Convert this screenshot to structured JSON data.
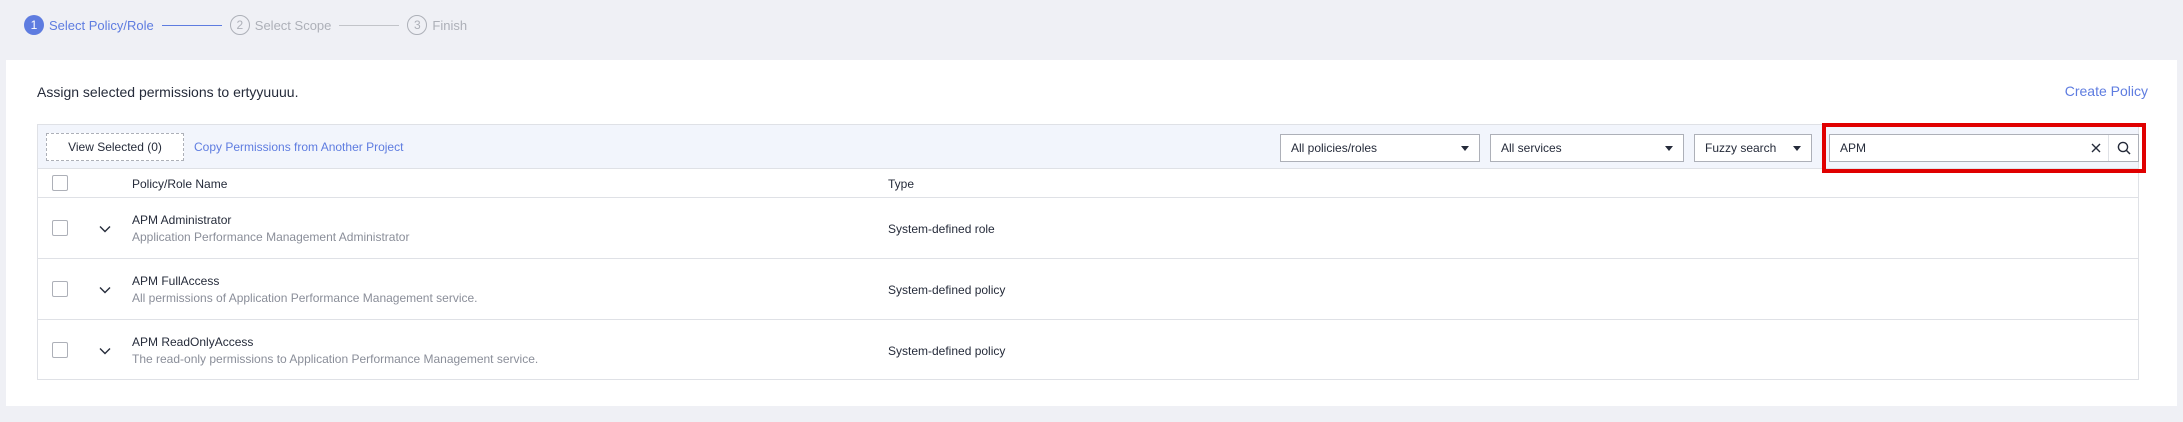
{
  "stepper": {
    "steps": [
      {
        "num": "1",
        "label": "Select Policy/Role",
        "state": "active"
      },
      {
        "num": "2",
        "label": "Select Scope",
        "state": "inactive"
      },
      {
        "num": "3",
        "label": "Finish",
        "state": "inactive"
      }
    ]
  },
  "header": {
    "assign_text": "Assign selected permissions to ertyyuuuu.",
    "create_policy": "Create Policy"
  },
  "toolbar": {
    "view_selected": "View Selected (0)",
    "copy_permissions": "Copy Permissions from Another Project",
    "policy_filter": "All policies/roles",
    "service_filter": "All services",
    "search_mode": "Fuzzy search",
    "search_value": "APM"
  },
  "table": {
    "columns": {
      "name": "Policy/Role Name",
      "type": "Type"
    },
    "rows": [
      {
        "name": "APM Administrator",
        "desc": "Application Performance Management Administrator",
        "type": "System-defined role"
      },
      {
        "name": "APM FullAccess",
        "desc": "All permissions of Application Performance Management service.",
        "type": "System-defined policy"
      },
      {
        "name": "APM ReadOnlyAccess",
        "desc": "The read-only permissions to Application Performance Management service.",
        "type": "System-defined policy"
      }
    ]
  },
  "colors": {
    "accent": "#5e7ce0",
    "highlight": "#e00000"
  }
}
